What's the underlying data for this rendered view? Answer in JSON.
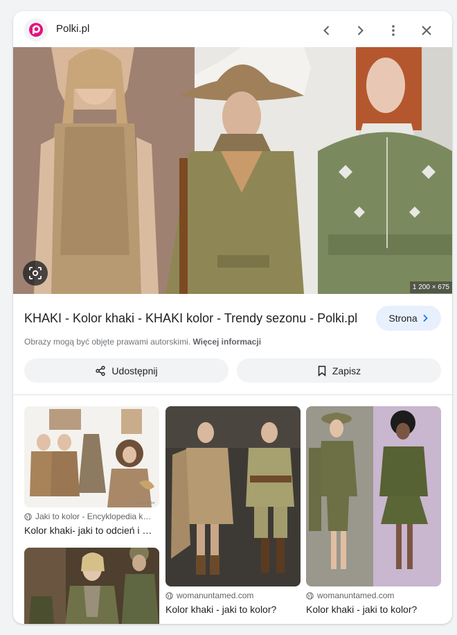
{
  "header": {
    "site_name": "Polki.pl",
    "logo_icon": "polki-logo-icon",
    "brand_color": "#e4137b"
  },
  "hero": {
    "dimensions": "1 200 × 675"
  },
  "result": {
    "title": "KHAKI - Kolor khaki - KHAKI kolor - Trendy sezonu - Polki.pl",
    "visit_label": "Strona",
    "copyright_text": "Obrazy mogą być objęte prawami autorskimi.",
    "more_info_label": "Więcej informacji",
    "share_label": "Udostępnij",
    "save_label": "Zapisz"
  },
  "related": [
    {
      "source": "Jaki to kolor - Encyklopedia k…",
      "caption": "Kolor khaki- jaki to odcień i …"
    },
    {
      "source": "womanuntamed.com",
      "caption": "Kolor khaki - jaki to kolor?"
    },
    {
      "source": "womanuntamed.com",
      "caption": "Kolor khaki - jaki to kolor?"
    },
    {
      "source": "",
      "caption": ""
    }
  ],
  "colors": {
    "khaki": "#8a8a5c",
    "accent_blue": "#1a73e8",
    "button_bg": "#f1f3f4"
  }
}
